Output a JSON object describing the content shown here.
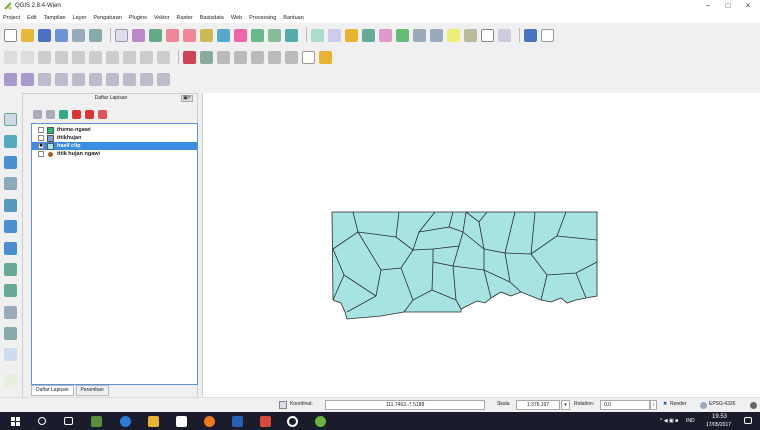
{
  "window": {
    "title": "QGIS 2.8.4-Wien",
    "minimize_glyph": "–",
    "maximize_glyph": "□",
    "close_glyph": "×"
  },
  "menu": [
    "Project",
    "Edit",
    "Tampilan",
    "Layer",
    "Pengaturan",
    "Plugins",
    "Vektor",
    "Raster",
    "Basisdata",
    "Web",
    "Processing",
    "Bantuan"
  ],
  "layers_panel": {
    "title": "Daftar Lapisan",
    "float_buttons": "▣×",
    "layers": [
      {
        "name": "theme-ngawi",
        "checked": false,
        "swatch": "#1fbe6a",
        "kind": "polygon"
      },
      {
        "name": "titikhujan",
        "checked": false,
        "swatch": "#7aa1e0",
        "kind": "polygon"
      },
      {
        "name": "hasil clip",
        "checked": true,
        "selected": true,
        "swatch": "#a7e3e3",
        "kind": "polygon"
      },
      {
        "name": "titik hujan ngawi",
        "checked": false,
        "swatch": "#a0612a",
        "kind": "point"
      }
    ],
    "check_glyph": "✖",
    "tabs": [
      "Daftar Lapisan",
      "Peramban"
    ]
  },
  "status": {
    "coordinate_label": "Koordinat:",
    "coordinate_value": "111.7463,-7.5188",
    "scale_label": "Skala",
    "scale_value": "1:375.197",
    "rotation_label": "Rotation:",
    "rotation_value": "0,0",
    "render_label": "Render",
    "crs": "EPSG:4326",
    "dropdown_glyph": "▾",
    "spin_glyph": "↕",
    "render_check_glyph": "✖"
  },
  "taskbar": {
    "time": "19.53",
    "date": "17/05/2017",
    "language": "IND"
  },
  "colors": {
    "polygon_fill": "#a7e3e3",
    "polygon_stroke": "#2a2a2a",
    "selection": "#3a8ee6",
    "taskbar": "#1b1c2b"
  }
}
